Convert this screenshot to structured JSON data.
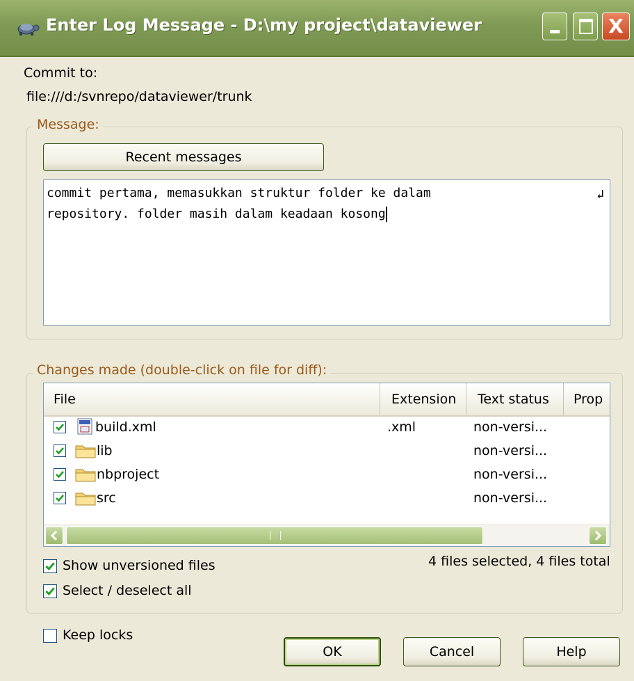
{
  "window": {
    "title": "Enter Log Message - D:\\my project\\dataviewer",
    "close_glyph": "X"
  },
  "commit": {
    "label": "Commit to:",
    "url": "file:///d:/svnrepo/dataviewer/trunk"
  },
  "message_group": {
    "legend": "Message:",
    "recent_button": "Recent messages",
    "text_line1": "commit pertama, memasukkan struktur folder ke dalam",
    "text_line2": "repository. folder masih dalam keadaan kosong",
    "wrap_marker": "↲"
  },
  "changes_group": {
    "legend": "Changes made (double-click on file for diff):",
    "columns": [
      "File",
      "Extension",
      "Text status",
      "Prop"
    ],
    "rows": [
      {
        "name": "build.xml",
        "extension": ".xml",
        "status": "non-versi...",
        "icon": "xml-file-icon",
        "checked": true
      },
      {
        "name": "lib",
        "extension": "",
        "status": "non-versi...",
        "icon": "folder-icon",
        "checked": true
      },
      {
        "name": "nbproject",
        "extension": "",
        "status": "non-versi...",
        "icon": "folder-icon",
        "checked": true
      },
      {
        "name": "src",
        "extension": "",
        "status": "non-versi...",
        "icon": "folder-icon",
        "checked": true
      }
    ],
    "show_unversioned": "Show unversioned files",
    "select_all": "Select / deselect all",
    "summary": "4 files selected, 4 files total"
  },
  "keep_locks": "Keep locks",
  "buttons": {
    "ok": "OK",
    "cancel": "Cancel",
    "help": "Help"
  },
  "colors": {
    "titlebar": "#7F9A55",
    "legend": "#9A5A1A",
    "checkmark": "#21A121"
  }
}
